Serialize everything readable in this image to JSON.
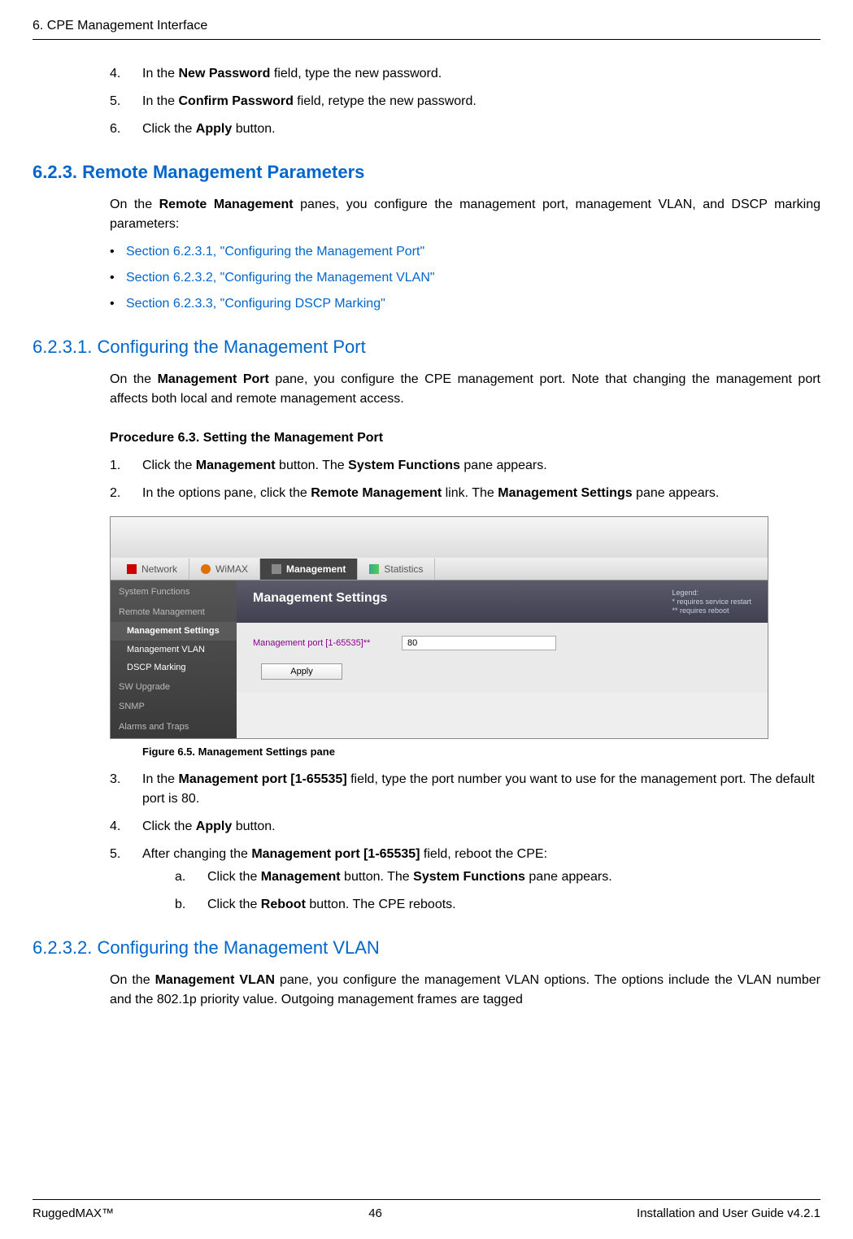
{
  "header": {
    "chapter": "6. CPE Management Interface"
  },
  "continuation_steps": {
    "s4": {
      "num": "4.",
      "prefix": "In the ",
      "bold": "New Password",
      "suffix": " field, type the new password."
    },
    "s5": {
      "num": "5.",
      "prefix": "In the ",
      "bold": "Confirm Password",
      "suffix": " field, retype the new password."
    },
    "s6": {
      "num": "6.",
      "prefix": "Click the ",
      "bold": "Apply",
      "suffix": " button."
    }
  },
  "section_623": {
    "title": "6.2.3. Remote Management Parameters",
    "intro_prefix": "On the ",
    "intro_bold": "Remote Management",
    "intro_suffix": " panes, you configure the management port, management VLAN, and DSCP marking parameters:",
    "links": [
      "Section 6.2.3.1, \"Configuring the Management Port\"",
      "Section 6.2.3.2, \"Configuring the Management VLAN\"",
      "Section 6.2.3.3, \"Configuring DSCP Marking\""
    ]
  },
  "section_6231": {
    "title": "6.2.3.1. Configuring the Management Port",
    "intro_prefix": "On the ",
    "intro_bold": "Management Port",
    "intro_suffix": " pane, you configure the CPE management port. Note that changing the management port affects both local and remote management access.",
    "procedure_title": "Procedure 6.3. Setting the Management Port",
    "steps": {
      "s1": {
        "num": "1.",
        "prefix": "Click the ",
        "bold1": "Management",
        "mid": " button. The ",
        "bold2": "System Functions",
        "suffix": " pane appears."
      },
      "s2": {
        "num": "2.",
        "prefix": "In the options pane, click the ",
        "bold1": "Remote Management",
        "mid": " link. The ",
        "bold2": "Management Settings",
        "suffix": " pane appears."
      },
      "s3": {
        "num": "3.",
        "prefix": "In the ",
        "bold": "Management port [1-65535]",
        "suffix": " field, type the port number you want to use for the management port. The default port is 80."
      },
      "s4": {
        "num": "4.",
        "prefix": "Click the ",
        "bold": "Apply",
        "suffix": " button."
      },
      "s5": {
        "num": "5.",
        "prefix": "After changing the ",
        "bold": "Management port [1-65535]",
        "suffix": " field, reboot the CPE:"
      },
      "s5a": {
        "num": "a.",
        "prefix": "Click the ",
        "bold1": "Management",
        "mid": " button. The ",
        "bold2": "System Functions",
        "suffix": " pane appears."
      },
      "s5b": {
        "num": "b.",
        "prefix": "Click the ",
        "bold1": "Reboot",
        "suffix": " button. The CPE reboots."
      }
    },
    "figure_caption": "Figure 6.5. Management Settings pane"
  },
  "section_6232": {
    "title": "6.2.3.2. Configuring the Management VLAN",
    "intro_prefix": "On the ",
    "intro_bold": "Management VLAN",
    "intro_suffix": " pane, you configure the management VLAN options. The options include the VLAN number and the 802.1p priority value. Outgoing management frames are tagged"
  },
  "ui": {
    "tabs": {
      "network": "Network",
      "wimax": "WiMAX",
      "management": "Management",
      "statistics": "Statistics"
    },
    "sidebar": {
      "system_functions": "System Functions",
      "remote_management": "Remote Management",
      "management_settings": "Management Settings",
      "management_vlan": "Management VLAN",
      "dscp_marking": "DSCP Marking",
      "sw_upgrade": "SW Upgrade",
      "snmp": "SNMP",
      "alarms_and_traps": "Alarms and Traps"
    },
    "main": {
      "title": "Management Settings",
      "legend_title": "Legend:",
      "legend_l1": "*  requires service restart",
      "legend_l2": "** requires reboot",
      "field_label": "Management port [1-65535]**",
      "field_value": "80",
      "apply_label": "Apply"
    }
  },
  "footer": {
    "left": "RuggedMAX™",
    "center": "46",
    "right": "Installation and User Guide v4.2.1"
  }
}
